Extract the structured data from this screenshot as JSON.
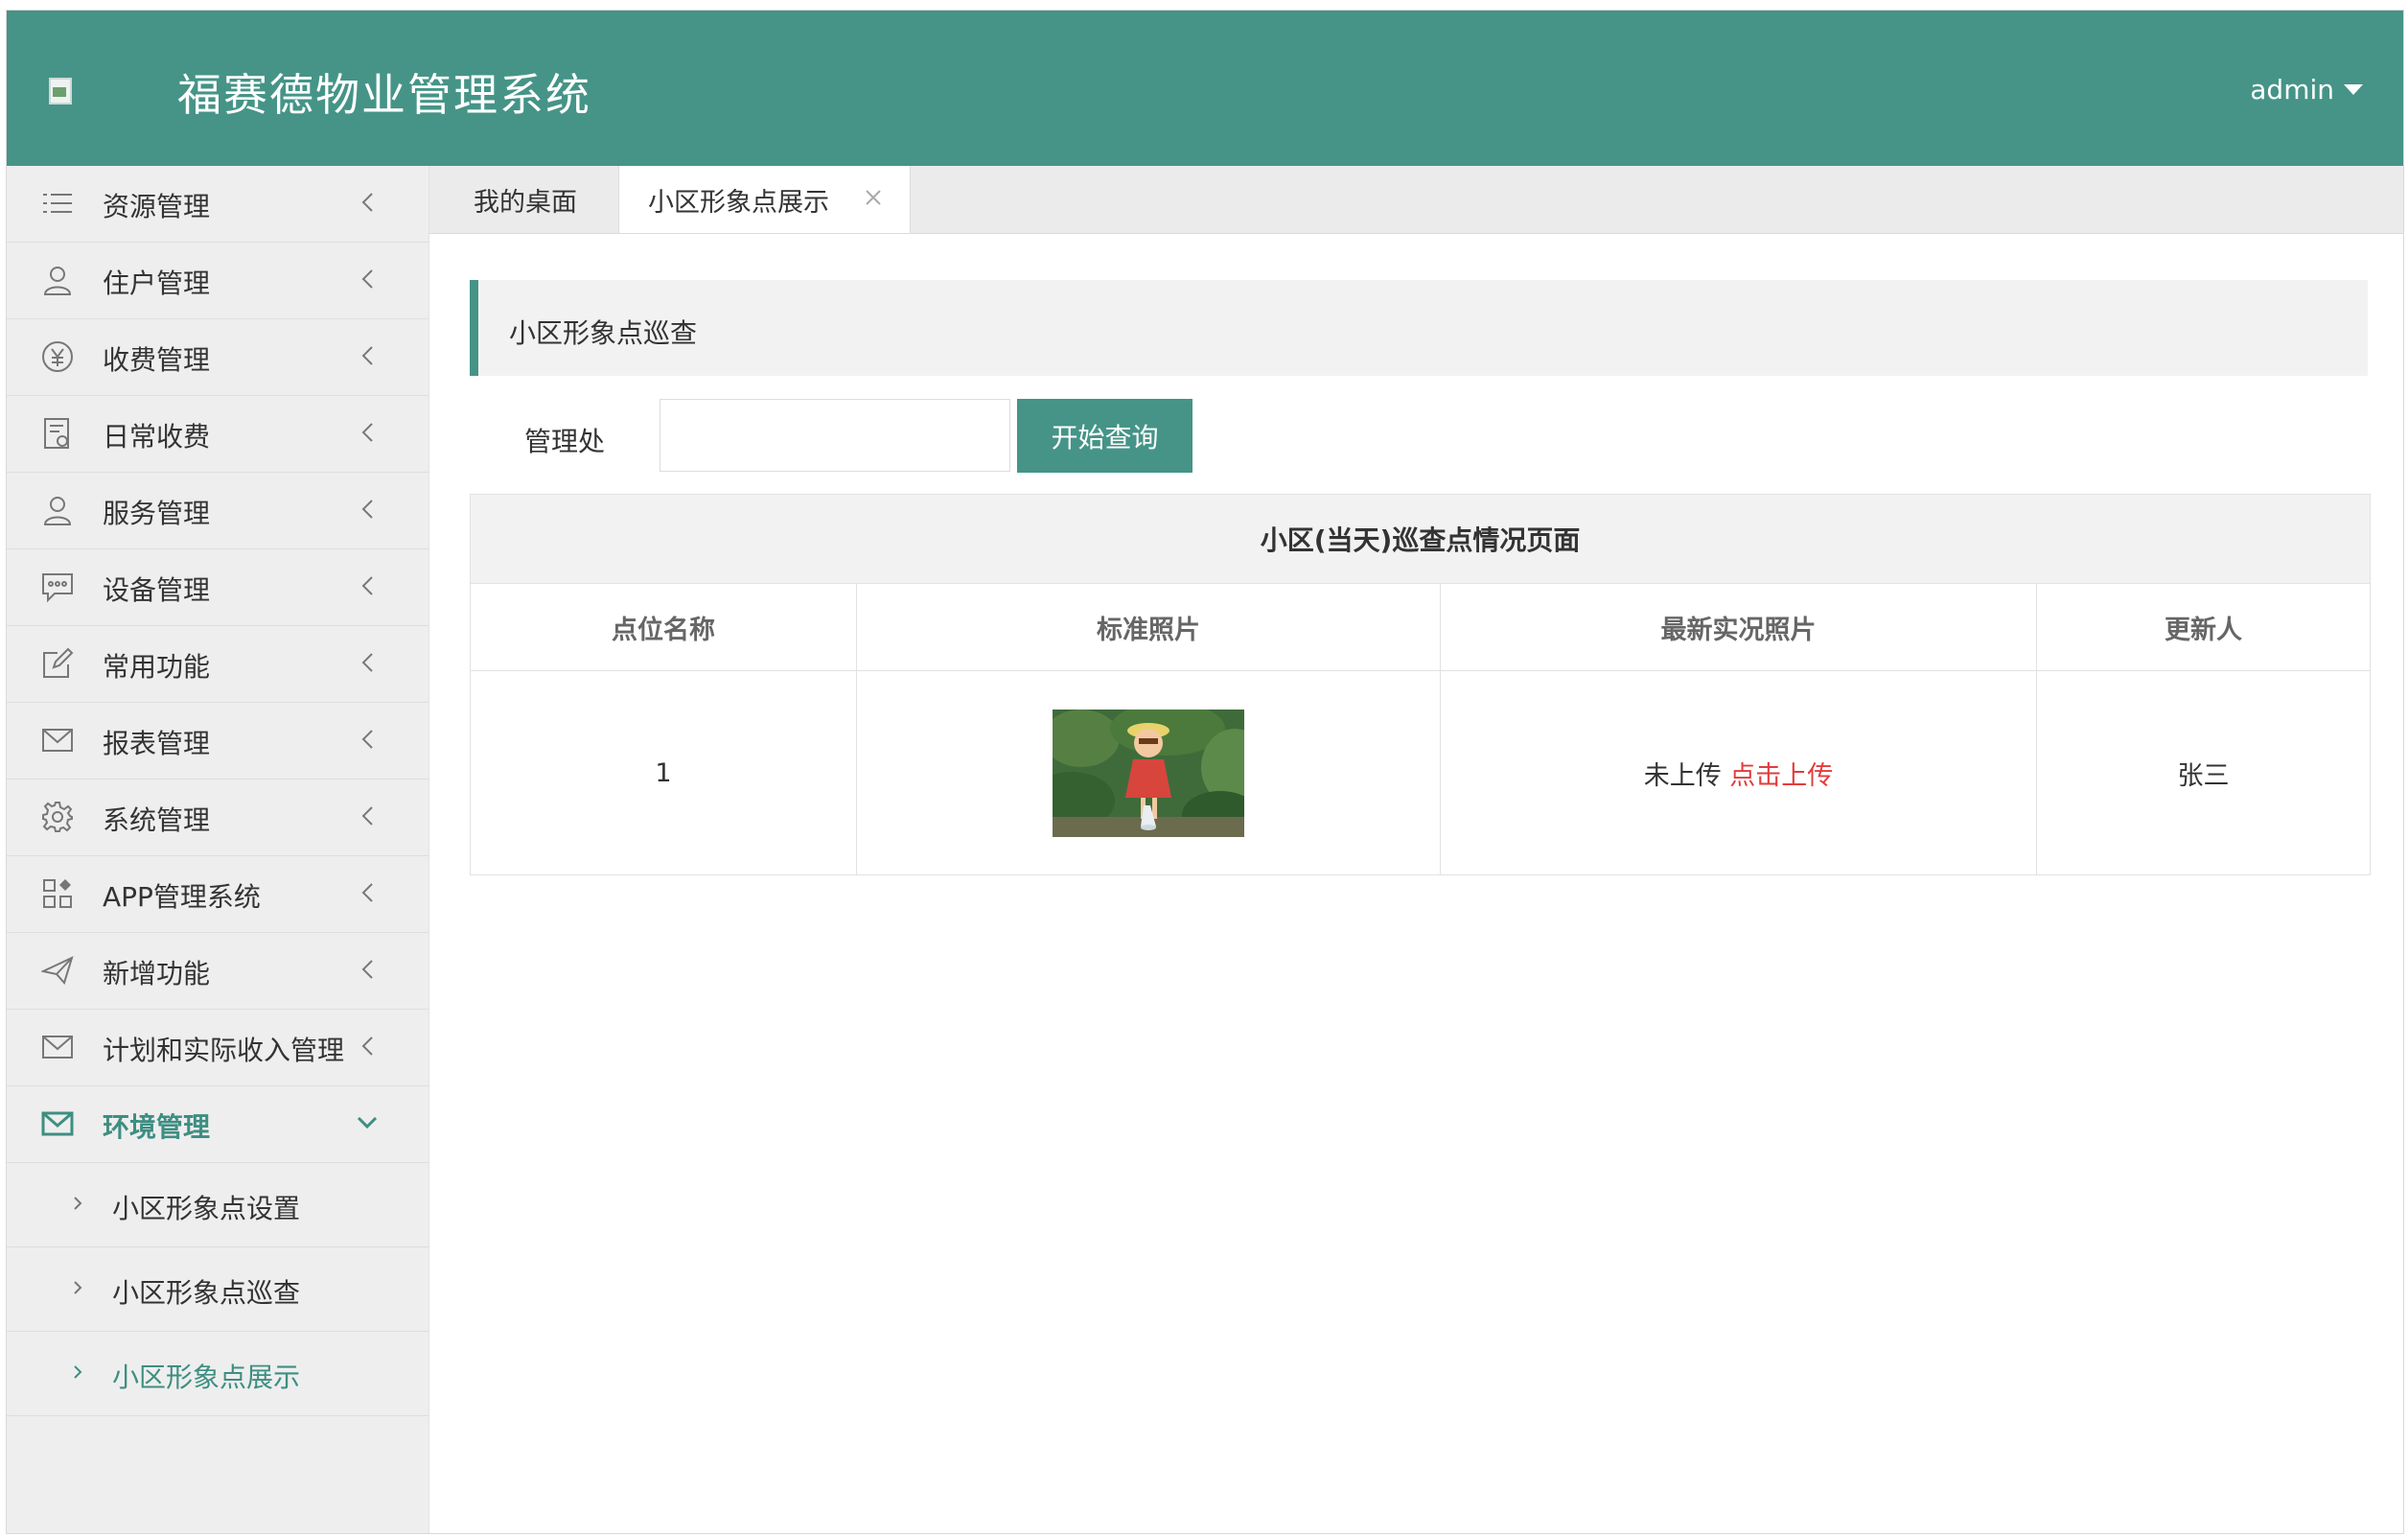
{
  "header": {
    "app_title": "福赛德物业管理系统",
    "user": "admin"
  },
  "sidebar": {
    "items": [
      {
        "label": "资源管理",
        "icon": "list-icon"
      },
      {
        "label": "住户管理",
        "icon": "user-icon"
      },
      {
        "label": "收费管理",
        "icon": "yuan-icon"
      },
      {
        "label": "日常收费",
        "icon": "receipt-icon"
      },
      {
        "label": "服务管理",
        "icon": "user-icon"
      },
      {
        "label": "设备管理",
        "icon": "message-icon"
      },
      {
        "label": "常用功能",
        "icon": "edit-icon"
      },
      {
        "label": "报表管理",
        "icon": "mail-icon"
      },
      {
        "label": "系统管理",
        "icon": "gear-icon"
      },
      {
        "label": "APP管理系统",
        "icon": "apps-icon"
      },
      {
        "label": "新增功能",
        "icon": "send-icon"
      },
      {
        "label": "计划和实际收入管理",
        "icon": "mail-icon"
      },
      {
        "label": "环境管理",
        "icon": "mail-icon",
        "expanded": true
      }
    ],
    "submenu": [
      {
        "label": "小区形象点设置"
      },
      {
        "label": "小区形象点巡查"
      },
      {
        "label": "小区形象点展示",
        "active": true
      }
    ]
  },
  "tabs": {
    "home": "我的桌面",
    "active": "小区形象点展示"
  },
  "section": {
    "title": "小区形象点巡查"
  },
  "form": {
    "label": "管理处",
    "value": "",
    "button": "开始查询"
  },
  "table": {
    "caption": "小区(当天)巡查点情况页面",
    "columns": [
      "点位名称",
      "标准照片",
      "最新实况照片",
      "更新人"
    ],
    "rows": [
      {
        "name": "1",
        "status": "未上传",
        "action": "点击上传",
        "updater": "张三"
      }
    ]
  },
  "colors": {
    "primary": "#459487",
    "active_text": "#3e8e82",
    "link_red": "#e23c3c",
    "sidebar_bg": "#eeeeee"
  }
}
